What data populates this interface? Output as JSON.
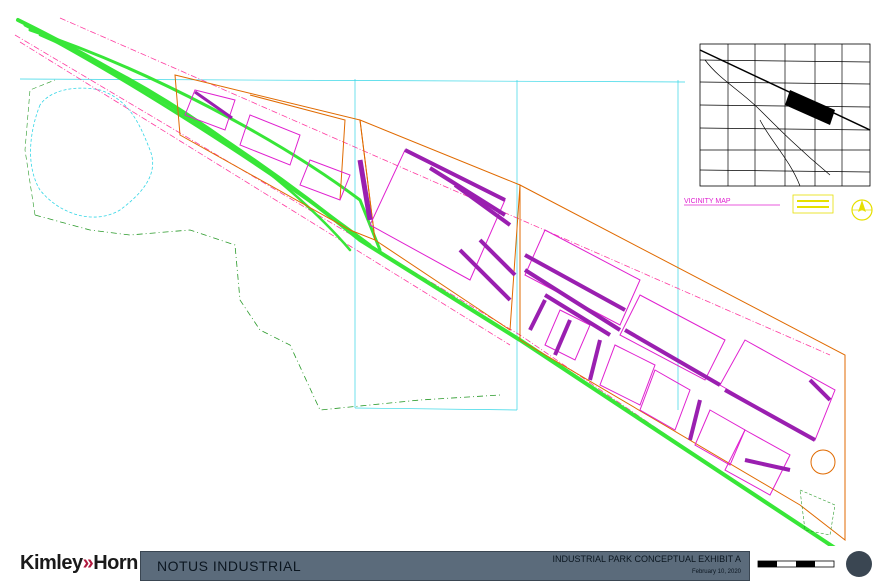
{
  "header": {
    "logo_part1": "Kimley",
    "logo_arrow": "»",
    "logo_part2": "Horn",
    "project_title": "NOTUS INDUSTRIAL",
    "sheet_title": "INDUSTRIAL PARK CONCEPTUAL EXHIBIT A",
    "date": "February 10, 2020"
  },
  "vicinity_map": {
    "label": "VICINITY MAP"
  },
  "colors": {
    "railway": "#38e638",
    "parcel_line": "#e06a00",
    "building_outline": "#e020d0",
    "parking": "#9a1fb0",
    "right_of_way": "#ff3aa0",
    "boundary": "#2a9a2a",
    "grid": "#33d6e6",
    "title_band": "#5b6b7b"
  },
  "icons": [
    "north-arrow-icon",
    "scale-bar-icon"
  ]
}
